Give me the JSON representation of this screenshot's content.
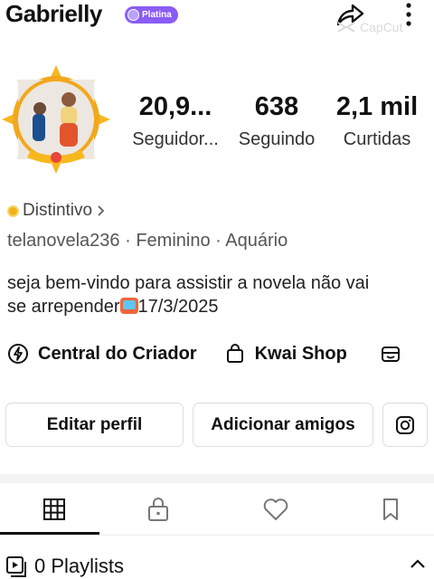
{
  "header": {
    "username": "Gabrielly",
    "badge": "Platina",
    "watermark": "CapCut"
  },
  "stats": [
    {
      "value": "20,9...",
      "label": "Seguidor..."
    },
    {
      "value": "638",
      "label": "Seguindo"
    },
    {
      "value": "2,1 mil",
      "label": "Curtidas"
    }
  ],
  "profile": {
    "distintivo": "Distintivo",
    "meta": "telanovela236 · Feminino · Aquário",
    "bio_line1": "seja bem-vindo para assistir a novela não vai",
    "bio_line2_a": "se arrepender",
    "bio_line2_b": "17/3/2025"
  },
  "links": {
    "creator": "Central do Criador",
    "shop": "Kwai Shop"
  },
  "buttons": {
    "edit": "Editar perfil",
    "add_friends": "Adicionar amigos"
  },
  "tabs": [
    "grid-icon",
    "lock-icon",
    "heart-icon",
    "bookmark-icon"
  ],
  "playlists": {
    "label": "0 Playlists"
  },
  "colors": {
    "badge": "#8a5cf6",
    "avatar_frame": "#f2a81d",
    "accent_text": "#111111"
  }
}
